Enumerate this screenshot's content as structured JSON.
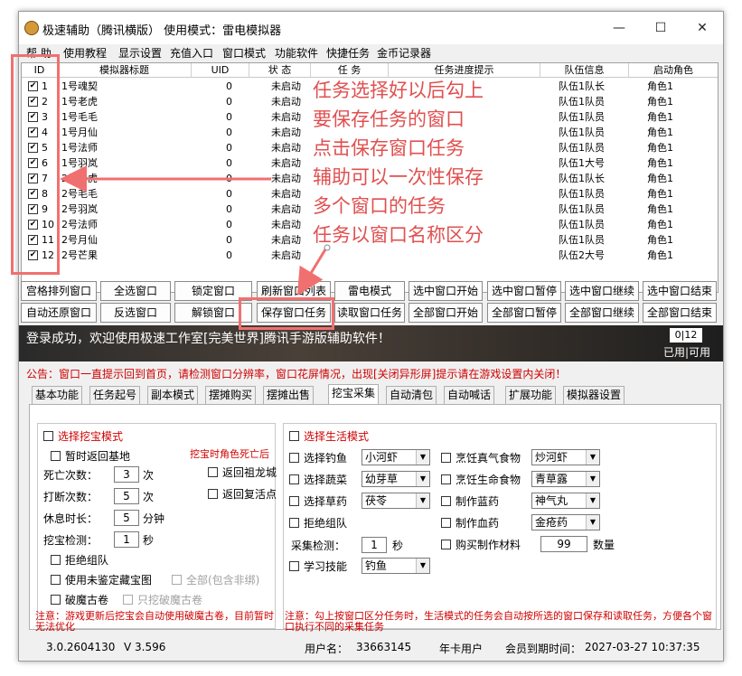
{
  "window": {
    "title": "极速辅助（腾讯横版）  使用模式：雷电模拟器",
    "min": "—",
    "max": "☐",
    "close": "✕"
  },
  "menu": [
    "帮 助",
    "使用教程",
    "显示设置",
    "充值入口",
    "窗口模式",
    "功能软件",
    "快捷任务",
    "金币记录器"
  ],
  "table": {
    "headers": [
      "ID",
      "模拟器标题",
      "UID",
      "状 态",
      "任 务",
      "任务进度提示",
      "队伍信息",
      "启动角色"
    ],
    "rows": [
      {
        "id": "1",
        "title": "1号魂契",
        "uid": "0",
        "status": "未启动",
        "team": "队伍1队长",
        "role": "角色1"
      },
      {
        "id": "2",
        "title": "1号老虎",
        "uid": "0",
        "status": "未启动",
        "team": "队伍1队员",
        "role": "角色1"
      },
      {
        "id": "3",
        "title": "1号毛毛",
        "uid": "0",
        "status": "未启动",
        "team": "队伍1队员",
        "role": "角色1"
      },
      {
        "id": "4",
        "title": "1号月仙",
        "uid": "0",
        "status": "未启动",
        "team": "队伍1队员",
        "role": "角色1"
      },
      {
        "id": "5",
        "title": "1号法师",
        "uid": "0",
        "status": "未启动",
        "team": "队伍1队员",
        "role": "角色1"
      },
      {
        "id": "6",
        "title": "1号羽岚",
        "uid": "0",
        "status": "未启动",
        "team": "队伍1大号",
        "role": "角色1"
      },
      {
        "id": "7",
        "title": "2号老虎",
        "uid": "0",
        "status": "未启动",
        "team": "队伍1队长",
        "role": "角色1"
      },
      {
        "id": "8",
        "title": "2号毛毛",
        "uid": "0",
        "status": "未启动",
        "team": "队伍1队员",
        "role": "角色1"
      },
      {
        "id": "9",
        "title": "2号羽岚",
        "uid": "0",
        "status": "未启动",
        "team": "队伍1队员",
        "role": "角色1"
      },
      {
        "id": "10",
        "title": "2号法师",
        "uid": "0",
        "status": "未启动",
        "team": "队伍1队员",
        "role": "角色1"
      },
      {
        "id": "11",
        "title": "2号月仙",
        "uid": "0",
        "status": "未启动",
        "team": "队伍1队员",
        "role": "角色1"
      },
      {
        "id": "12",
        "title": "2号芒果",
        "uid": "0",
        "status": "未启动",
        "team": "队伍2大号",
        "role": "角色1"
      }
    ]
  },
  "buttons_row1": [
    "宫格排列窗口",
    "全选窗口",
    "锁定窗口",
    "刷新窗口列表",
    "雷电模式",
    "选中窗口开始",
    "选中窗口暂停",
    "选中窗口继续",
    "选中窗口结束"
  ],
  "buttons_row2": [
    "自动还原窗口",
    "反选窗口",
    "解锁窗口",
    "保存窗口任务",
    "读取窗口任务",
    "全部窗口开始",
    "全部窗口暂停",
    "全部窗口继续",
    "全部窗口结束"
  ],
  "banner": {
    "text": "登录成功，欢迎使用极速工作室[完美世界]腾讯手游版辅助软件！",
    "slots": "0|12",
    "slots_label": "已用|可用"
  },
  "notice": "公告：窗口一直提示回到首页，请检测窗口分辨率，窗口花屏情况，出现[关闭异形屏]提示请在游戏设置内关闭！",
  "tabs": [
    "基本功能",
    "任务起号",
    "副本模式",
    "摆摊购买",
    "摆摊出售",
    "挖宝采集",
    "自动清包",
    "自动喊话",
    "扩展功能",
    "模拟器设置"
  ],
  "treasure": {
    "title": "选择挖宝模式",
    "back_base": "暂时返回基地",
    "death_label": "死亡次数：",
    "death_val": "3",
    "death_unit": "次",
    "interrupt_label": "打断次数：",
    "interrupt_val": "5",
    "interrupt_unit": "次",
    "rest_label": "休息时长：",
    "rest_val": "5",
    "rest_unit": "分钟",
    "detect_label": "挖宝检测：",
    "detect_val": "1",
    "detect_unit": "秒",
    "death_note": "挖宝时角色死亡后",
    "back_city": "返回祖龙城",
    "back_revive": "返回复活点",
    "refuse_team": "拒绝组队",
    "use_unknown": "使用未鉴定藏宝图",
    "all_bind": "全部(包含非绑)",
    "break_scroll": "破魔古卷",
    "only_break": "只挖破魔古卷",
    "note": "注意：游戏更新后挖宝会自动使用破魔古卷，目前暂时无法优化"
  },
  "life": {
    "title": "选择生活模式",
    "fish_label": "选择钓鱼",
    "fish_val": "小河虾",
    "veg_label": "选择蔬菜",
    "veg_val": "幼芽草",
    "herb_label": "选择草药",
    "herb_val": "茯苓",
    "refuse_team": "拒绝组队",
    "collect_label": "采集检测：",
    "collect_val": "1",
    "collect_unit": "秒",
    "skill_label": "学习技能",
    "skill_val": "钓鱼",
    "cook_qi_label": "烹饪真气食物",
    "cook_qi_val": "炒河虾",
    "cook_life_label": "烹饪生命食物",
    "cook_life_val": "青草露",
    "blue_label": "制作蓝药",
    "blue_val": "神气丸",
    "blood_label": "制作血药",
    "blood_val": "金疮药",
    "buy_label": "购买制作材料",
    "buy_val": "99",
    "buy_unit": "数量",
    "note": "注意：勾上按窗口区分任务时，生活模式的任务会自动按所选的窗口保存和读取任务，方便各个窗口执行不同的采集任务"
  },
  "status": {
    "version": "3.0.2604130",
    "v": "V 3.596",
    "user_label": "用户名：",
    "user": "33663145",
    "card": "年卡用户",
    "expire_label": "会员到期时间：",
    "expire": "2027-03-27  10:37:35"
  },
  "annotation": [
    "任务选择好以后勾上",
    "要保存任务的窗口",
    "点击保存窗口任务",
    "辅助可以一次性保存",
    "多个窗口的任务",
    "任务以窗口名称区分"
  ]
}
